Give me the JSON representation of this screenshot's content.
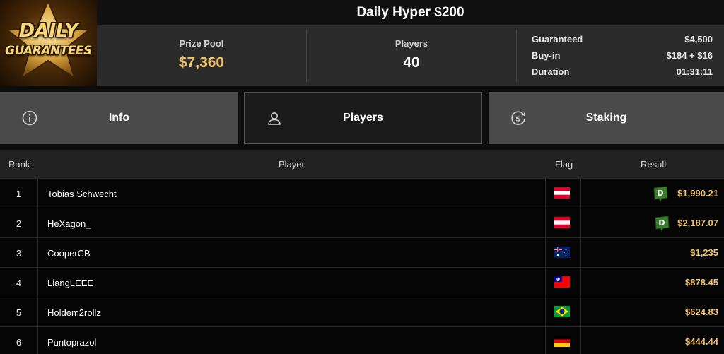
{
  "logo": {
    "line1": "DAILY",
    "line2": "GUARANTEES"
  },
  "title": "Daily Hyper $200",
  "stats": {
    "prize_pool_label": "Prize Pool",
    "prize_pool_value": "$7,360",
    "players_label": "Players",
    "players_value": "40",
    "guaranteed_label": "Guaranteed",
    "guaranteed_value": "$4,500",
    "buyin_label": "Buy-in",
    "buyin_value": "$184 + $16",
    "duration_label": "Duration",
    "duration_value": "01:31:11"
  },
  "tabs": [
    {
      "label": "Info",
      "icon": "info-icon"
    },
    {
      "label": "Players",
      "icon": "user-icon",
      "active": true
    },
    {
      "label": "Staking",
      "icon": "staking-icon"
    }
  ],
  "table": {
    "headers": {
      "rank": "Rank",
      "player": "Player",
      "flag": "Flag",
      "result": "Result"
    },
    "rows": [
      {
        "rank": "1",
        "player": "Tobias Schwecht",
        "flag": "austria-flag",
        "result": "$1,990.21",
        "badge": "D"
      },
      {
        "rank": "2",
        "player": "HeXagon_",
        "flag": "austria-flag",
        "result": "$2,187.07",
        "badge": "D"
      },
      {
        "rank": "3",
        "player": "CooperCB",
        "flag": "australia-flag",
        "result": "$1,235"
      },
      {
        "rank": "4",
        "player": "LiangLEEE",
        "flag": "taiwan-flag",
        "result": "$878.45"
      },
      {
        "rank": "5",
        "player": "Holdem2rollz",
        "flag": "brazil-flag",
        "result": "$624.83"
      },
      {
        "rank": "6",
        "player": "Puntoprazol",
        "flag": "germany-flag",
        "result": "$444.44"
      }
    ]
  },
  "colors": {
    "gold": "#f0c36a",
    "tab_bg": "#4a4a4a",
    "active_tab_bg": "#1b1b1b",
    "badge_green": "#3a7d2c"
  }
}
